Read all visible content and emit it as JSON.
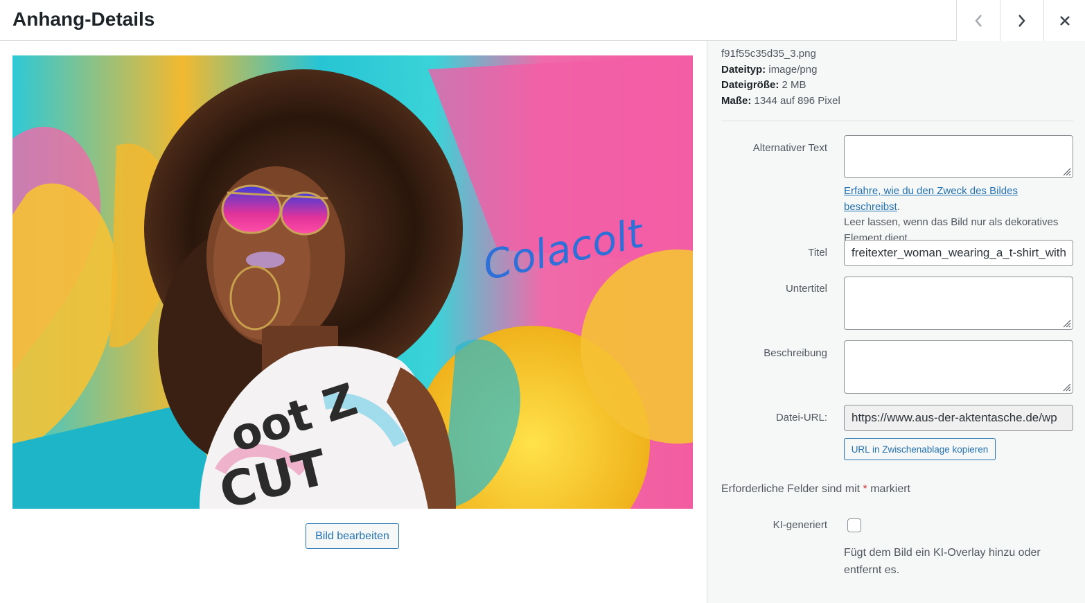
{
  "header": {
    "title": "Anhang-Details",
    "prev_icon": "chevron-left-icon",
    "next_icon": "chevron-right-icon",
    "close_icon": "close-icon"
  },
  "media": {
    "edit_button": "Bild bearbeiten",
    "image_alt": "Frau mit Sonnenbrille vor bunter Graffiti-Wand"
  },
  "details": {
    "filename": "f91f55c35d35_3.png",
    "filetype_label": "Dateityp:",
    "filetype_value": "image/png",
    "filesize_label": "Dateigröße:",
    "filesize_value": "2 MB",
    "dimensions_label": "Maße:",
    "dimensions_value": "1344 auf 896 Pixel"
  },
  "form": {
    "alt_label": "Alternativer Text",
    "alt_value": "",
    "alt_help_link": "Erfahre, wie du den Zweck des Bildes beschreibst",
    "alt_help_dot": ".",
    "alt_help_text": "Leer lassen, wenn das Bild nur als dekoratives Element dient.",
    "title_label": "Titel",
    "title_value": "freitexter_woman_wearing_a_t-shirt_with",
    "caption_label": "Untertitel",
    "caption_value": "",
    "description_label": "Beschreibung",
    "description_value": "",
    "url_label": "Datei-URL:",
    "url_value": "https://www.aus-der-aktentasche.de/wp",
    "copy_button": "URL in Zwischenablage kopieren",
    "required_prefix": "Erforderliche Felder sind mit",
    "required_star": "*",
    "required_suffix": "markiert",
    "ki_label": "KI-generiert",
    "ki_checked": false,
    "ki_help": "Fügt dem Bild ein KI-Overlay hinzu oder entfernt es."
  },
  "colors": {
    "accent": "#2271b1",
    "sidebar_bg": "#f6f7f7",
    "required": "#d63638"
  }
}
